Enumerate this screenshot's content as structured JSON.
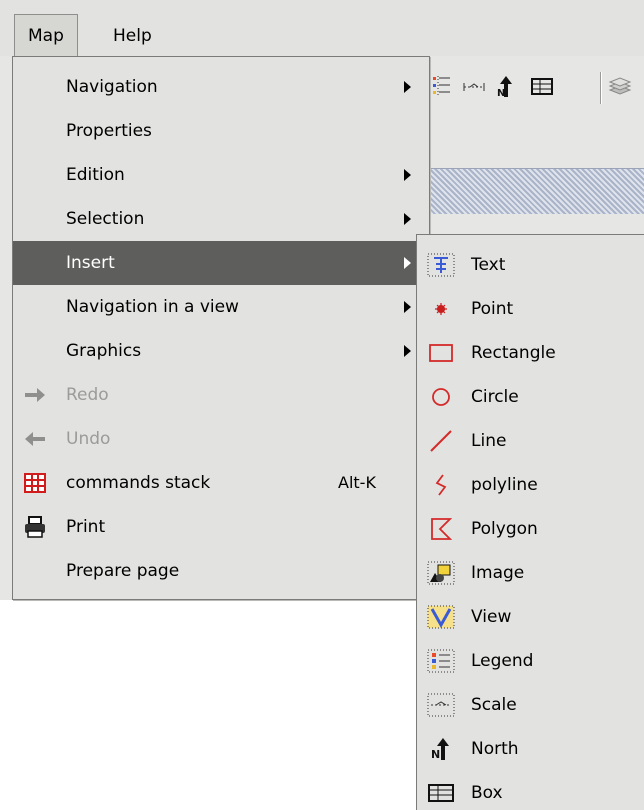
{
  "menubar": {
    "items": [
      {
        "label": "Map"
      },
      {
        "label": "Help"
      }
    ]
  },
  "map_menu": {
    "items": [
      {
        "label": "Navigation",
        "submenu": true,
        "state": "normal"
      },
      {
        "label": "Properties",
        "submenu": false,
        "state": "normal"
      },
      {
        "label": "Edition",
        "submenu": true,
        "state": "normal"
      },
      {
        "label": "Selection",
        "submenu": true,
        "state": "normal"
      },
      {
        "label": "Insert",
        "submenu": true,
        "state": "selected"
      },
      {
        "label": "Navigation in a view",
        "submenu": true,
        "state": "normal"
      },
      {
        "label": "Graphics",
        "submenu": true,
        "state": "normal"
      },
      {
        "label": "Redo",
        "submenu": false,
        "state": "disabled",
        "icon": "arrow-right-icon"
      },
      {
        "label": "Undo",
        "submenu": false,
        "state": "disabled",
        "icon": "arrow-left-icon"
      },
      {
        "label": "commands stack",
        "accelerator": "Alt-K",
        "submenu": false,
        "state": "normal",
        "icon": "command-stack-icon"
      },
      {
        "label": "Print",
        "submenu": false,
        "state": "normal",
        "icon": "printer-icon"
      },
      {
        "label": "Prepare page",
        "submenu": false,
        "state": "normal"
      }
    ]
  },
  "insert_submenu": {
    "items": [
      {
        "label": "Text",
        "icon": "text-icon"
      },
      {
        "label": "Point",
        "icon": "point-icon"
      },
      {
        "label": "Rectangle",
        "icon": "rectangle-icon"
      },
      {
        "label": "Circle",
        "icon": "circle-icon"
      },
      {
        "label": "Line",
        "icon": "line-icon"
      },
      {
        "label": "polyline",
        "icon": "polyline-icon"
      },
      {
        "label": "Polygon",
        "icon": "polygon-icon"
      },
      {
        "label": "Image",
        "icon": "image-icon"
      },
      {
        "label": "View",
        "icon": "view-icon"
      },
      {
        "label": "Legend",
        "icon": "legend-icon"
      },
      {
        "label": "Scale",
        "icon": "scale-icon"
      },
      {
        "label": "North",
        "icon": "north-icon"
      },
      {
        "label": "Box",
        "icon": "box-icon"
      }
    ]
  },
  "toolbar": {
    "icons": [
      "legend-icon",
      "scale-icon",
      "north-icon",
      "box-icon",
      "layers-icon"
    ]
  },
  "colors": {
    "menu_bg": "#e2e3e0",
    "selected_bg": "#5e5e5c",
    "disabled_text": "#9b9b99",
    "shape_red": "#d42a2a",
    "icon_blue": "#3b5bd6"
  }
}
